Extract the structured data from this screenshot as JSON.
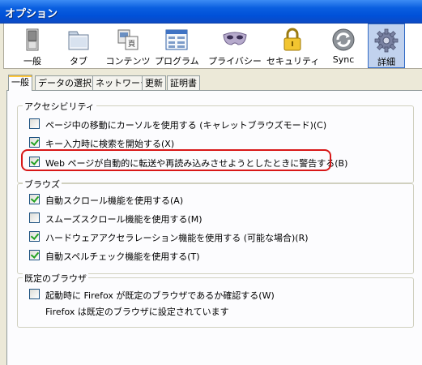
{
  "window": {
    "title": "オプション"
  },
  "toolbar": {
    "items": [
      {
        "label": "一般",
        "icon": "switch-icon"
      },
      {
        "label": "タブ",
        "icon": "tabs-icon"
      },
      {
        "label": "コンテンツ",
        "icon": "content-icon"
      },
      {
        "label": "プログラム",
        "icon": "applications-icon"
      },
      {
        "label": "プライバシー",
        "icon": "mask-icon"
      },
      {
        "label": "セキュリティ",
        "icon": "padlock-icon"
      },
      {
        "label": "Sync",
        "icon": "sync-icon"
      },
      {
        "label": "詳細",
        "icon": "gear-icon",
        "selected": true
      }
    ]
  },
  "tabs": [
    {
      "label": "一般",
      "active": true
    },
    {
      "label": "データの選択"
    },
    {
      "label": "ネットワーク"
    },
    {
      "label": "更新"
    },
    {
      "label": "証明書"
    }
  ],
  "accessibility": {
    "legend": "アクセシビリティ",
    "options": [
      {
        "label": "ページ中の移動にカーソルを使用する (キャレットブラウズモード)(C)",
        "checked": false
      },
      {
        "label": "キー入力時に検索を開始する(X)",
        "checked": true
      },
      {
        "label": "Web ページが自動的に転送や再読み込みさせようとしたときに警告する(B)",
        "checked": true,
        "highlighted": true
      }
    ]
  },
  "browsing": {
    "legend": "ブラウズ",
    "options": [
      {
        "label": "自動スクロール機能を使用する(A)",
        "checked": true
      },
      {
        "label": "スムーズスクロール機能を使用する(M)",
        "checked": false
      },
      {
        "label": "ハードウェアアクセラレーション機能を使用する (可能な場合)(R)",
        "checked": true
      },
      {
        "label": "自動スペルチェック機能を使用する(T)",
        "checked": true
      }
    ]
  },
  "default_browser": {
    "legend": "既定のブラウザ",
    "option": {
      "label": "起動時に Firefox が既定のブラウザであるか確認する(W)",
      "checked": false
    },
    "status": "Firefox は既定のブラウザに設定されています"
  },
  "colors": {
    "highlight": "#d81818",
    "checkmark": "#21a121",
    "selected_toolbar_bg": "#c1d2ee"
  }
}
